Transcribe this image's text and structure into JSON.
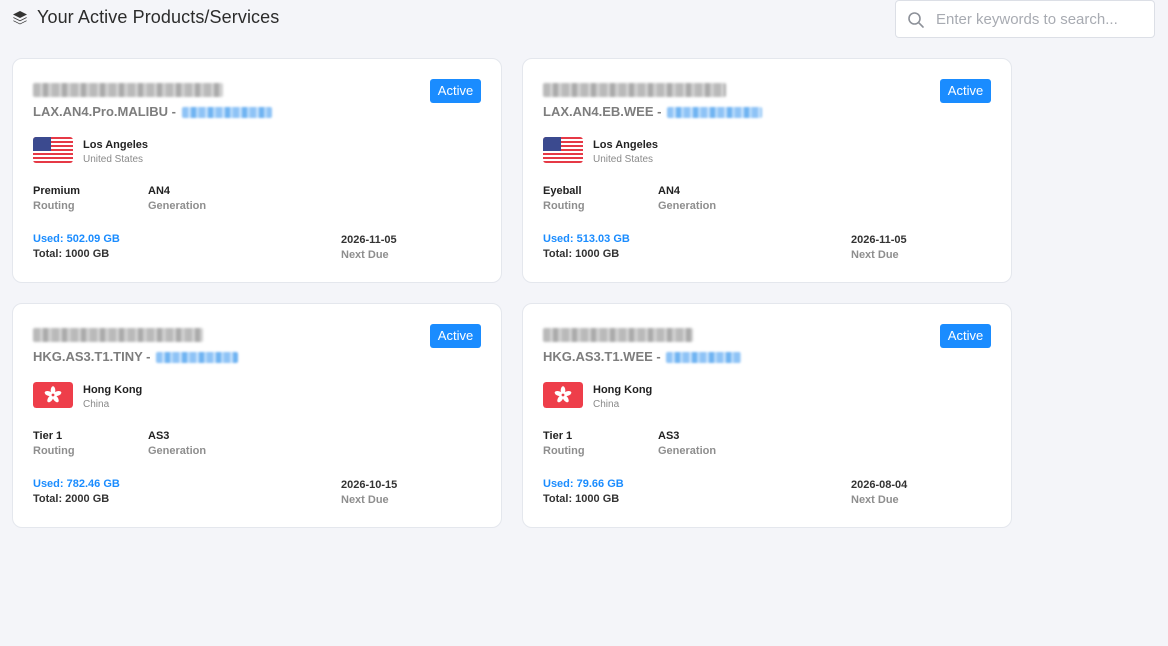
{
  "header": {
    "title": "Your Active Products/Services",
    "icon": "layers-icon"
  },
  "search": {
    "placeholder": "Enter keywords to search...",
    "value": ""
  },
  "colors": {
    "accent": "#1a8cff",
    "page_bg": "#f4f5f9"
  },
  "products": [
    {
      "plan": "LAX.AN4.Pro.MALIBU",
      "status": "Active",
      "flag": "us-flag-icon",
      "city": "Los Angeles",
      "country": "United States",
      "routing": "Premium",
      "routing_label": "Routing",
      "generation": "AN4",
      "generation_label": "Generation",
      "used": "Used: 502.09 GB",
      "total": "Total: 1000 GB",
      "next_due": "2026-11-05",
      "next_due_label": "Next Due"
    },
    {
      "plan": "LAX.AN4.EB.WEE",
      "status": "Active",
      "flag": "us-flag-icon",
      "city": "Los Angeles",
      "country": "United States",
      "routing": "Eyeball",
      "routing_label": "Routing",
      "generation": "AN4",
      "generation_label": "Generation",
      "used": "Used: 513.03 GB",
      "total": "Total: 1000 GB",
      "next_due": "2026-11-05",
      "next_due_label": "Next Due"
    },
    {
      "plan": "HKG.AS3.T1.TINY",
      "status": "Active",
      "flag": "hk-flag-icon",
      "city": "Hong Kong",
      "country": "China",
      "routing": "Tier 1",
      "routing_label": "Routing",
      "generation": "AS3",
      "generation_label": "Generation",
      "used": "Used: 782.46 GB",
      "total": "Total: 2000 GB",
      "next_due": "2026-10-15",
      "next_due_label": "Next Due"
    },
    {
      "plan": "HKG.AS3.T1.WEE",
      "status": "Active",
      "flag": "hk-flag-icon",
      "city": "Hong Kong",
      "country": "China",
      "routing": "Tier 1",
      "routing_label": "Routing",
      "generation": "AS3",
      "generation_label": "Generation",
      "used": "Used: 79.66 GB",
      "total": "Total: 1000 GB",
      "next_due": "2026-08-04",
      "next_due_label": "Next Due"
    }
  ]
}
